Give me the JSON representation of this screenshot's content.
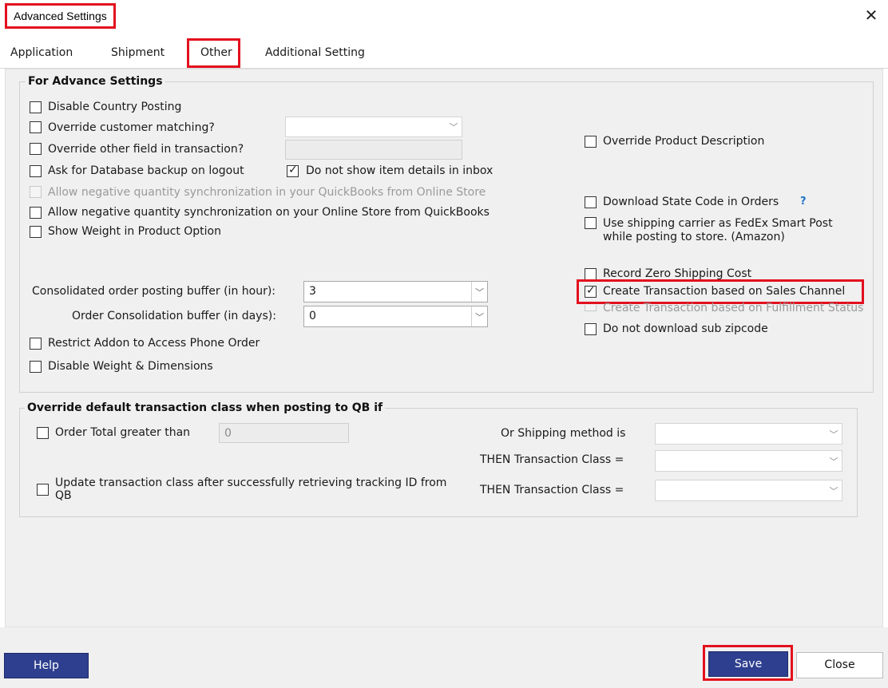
{
  "window": {
    "title": "Advanced Settings",
    "close_glyph": "✕"
  },
  "tabs": [
    {
      "label": "Application"
    },
    {
      "label": "Shipment"
    },
    {
      "label": "Other"
    },
    {
      "label": "Additional Setting"
    }
  ],
  "advance": {
    "legend": "For Advance Settings",
    "disable_country_posting": "Disable Country Posting",
    "override_customer_matching": "Override customer matching?",
    "override_other_field": "Override other field in transaction?",
    "ask_db_backup": "Ask for Database backup on logout",
    "do_not_show_item_details": "Do not show item details in inbox",
    "allow_neg_qb_from_store": "Allow negative quantity synchronization in your QuickBooks from  Online Store",
    "allow_neg_store_from_qb": "Allow negative quantity synchronization on your Online Store from QuickBooks",
    "show_weight": "Show Weight in Product Option",
    "consolidated_label": "Consolidated order posting buffer (in hour):",
    "consolidated_value": "3",
    "order_consolidation_label": "Order Consolidation buffer (in days):",
    "order_consolidation_value": "0",
    "restrict_addon": "Restrict Addon to Access Phone Order",
    "disable_weight_dim": "Disable Weight & Dimensions",
    "override_product_desc": "Override Product Description",
    "download_state_code": "Download State Code in Orders",
    "help_mark": "?",
    "use_shipping_carrier_1": "Use shipping carrier as FedEx Smart Post",
    "use_shipping_carrier_2": "while posting to store. (Amazon)",
    "record_zero_shipping": "Record Zero Shipping Cost",
    "create_tx_sales_channel": "Create Transaction based on Sales Channel",
    "create_tx_fulfillment": "Create Transaction based on Fulfillment Status",
    "no_sub_zipcode": "Do not download sub zipcode"
  },
  "override_class": {
    "legend": "Override default transaction class when posting to QB if",
    "order_total_label": "Order Total greater than",
    "order_total_value": "0",
    "update_class_line1": "Update transaction class after successfully retrieving tracking ID from",
    "update_class_line2": "QB",
    "shipping_method_label": "Or Shipping method is",
    "then_class_label_1": "THEN Transaction Class =",
    "then_class_label_2": "THEN Transaction Class ="
  },
  "footer": {
    "help": "Help",
    "save": "Save",
    "close": "Close"
  },
  "colors": {
    "highlight": "#e3101e",
    "button_primary": "#2e3f8f",
    "help_mark": "#1e73c8"
  }
}
